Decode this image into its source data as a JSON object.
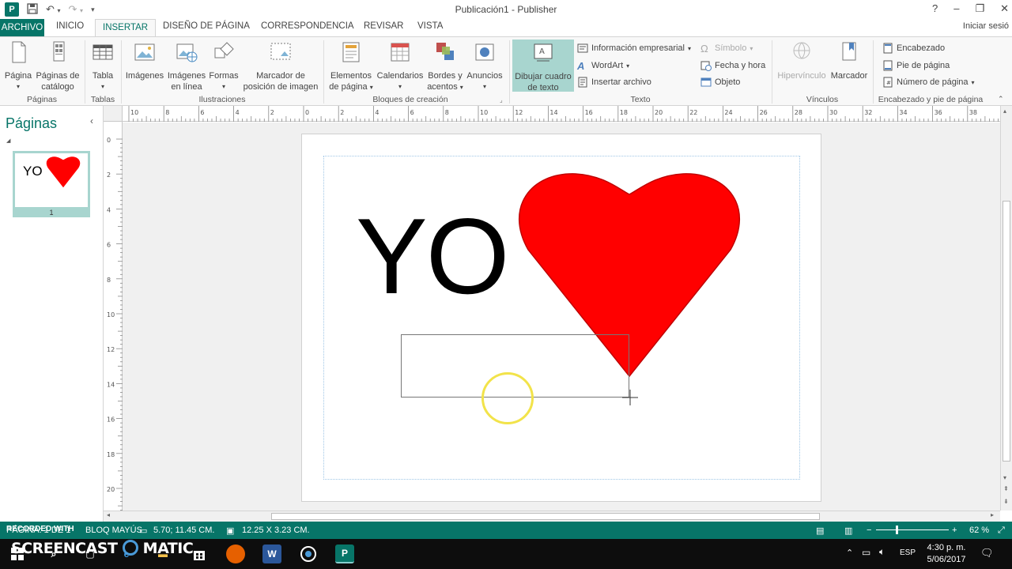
{
  "window": {
    "title": "Publicación1 - Publisher",
    "controls": [
      "?",
      "–",
      "❐",
      "✕"
    ]
  },
  "tabs": {
    "file": "ARCHIVO",
    "items": [
      "INICIO",
      "INSERTAR",
      "DISEÑO DE PÁGINA",
      "CORRESPONDENCIA",
      "REVISAR",
      "VISTA"
    ],
    "active": "INSERTAR",
    "signin": "Iniciar sesió"
  },
  "ribbon": {
    "groups": {
      "paginas": "Páginas",
      "tablas": "Tablas",
      "ilustraciones": "Ilustraciones",
      "bloques": "Bloques de creación",
      "texto": "Texto",
      "vinculos": "Vínculos",
      "encabezado": "Encabezado y pie de página"
    },
    "buttons": {
      "pagina": "Página",
      "paginas_catalogo_1": "Páginas de",
      "paginas_catalogo_2": "catálogo",
      "tabla": "Tabla",
      "imagenes": "Imágenes",
      "imagenes_linea_1": "Imágenes",
      "imagenes_linea_2": "en línea",
      "formas": "Formas",
      "marcador_pos_1": "Marcador de",
      "marcador_pos_2": "posición de imagen",
      "elementos_1": "Elementos",
      "elementos_2": "de página",
      "calendarios": "Calendarios",
      "bordes_1": "Bordes y",
      "bordes_2": "acentos",
      "anuncios": "Anuncios",
      "dibujar_1": "Dibujar cuadro",
      "dibujar_2": "de texto",
      "info_empresarial": "Información empresarial",
      "wordart": "WordArt",
      "insertar_archivo": "Insertar archivo",
      "simbolo": "Símbolo",
      "fecha_hora": "Fecha y hora",
      "objeto": "Objeto",
      "hipervinculo": "Hipervínculo",
      "marcador": "Marcador",
      "encabezado": "Encabezado",
      "pie_pagina": "Pie de página",
      "numero_pagina": "Número de página"
    }
  },
  "pages_pane": {
    "title": "Páginas",
    "thumb_text": "YO",
    "thumb_number": "1"
  },
  "rulers": {
    "h_labels": [
      "10",
      "8",
      "6",
      "4",
      "2",
      "0",
      "2",
      "4",
      "6",
      "8",
      "10",
      "12",
      "14",
      "16",
      "18",
      "20",
      "22",
      "24",
      "26",
      "28",
      "30",
      "32",
      "34",
      "36",
      "38"
    ],
    "v_labels": [
      "0",
      "2",
      "4",
      "6",
      "8",
      "10",
      "12",
      "14",
      "16",
      "18",
      "20"
    ]
  },
  "document": {
    "main_text": "YO",
    "heart_color": "#ff0000"
  },
  "statusbar": {
    "left": "PÁGINA: 1 DE 1",
    "caps": "BLOQ MAYÚS",
    "position": "5.70; 11.45 CM.",
    "size": "12.25 X 3.23 CM.",
    "zoom": "62 %"
  },
  "watermark": {
    "recorded": "RECORDED WITH",
    "brand": "SCREENCAST",
    "brand2": "MATIC"
  },
  "taskbar": {
    "lang": "ESP",
    "time": "4:30 p. m.",
    "date": "5/06/2017"
  },
  "colors": {
    "accent": "#077568",
    "ribbon_bg": "#f8f8f8",
    "highlight": "#a8d5cf"
  }
}
